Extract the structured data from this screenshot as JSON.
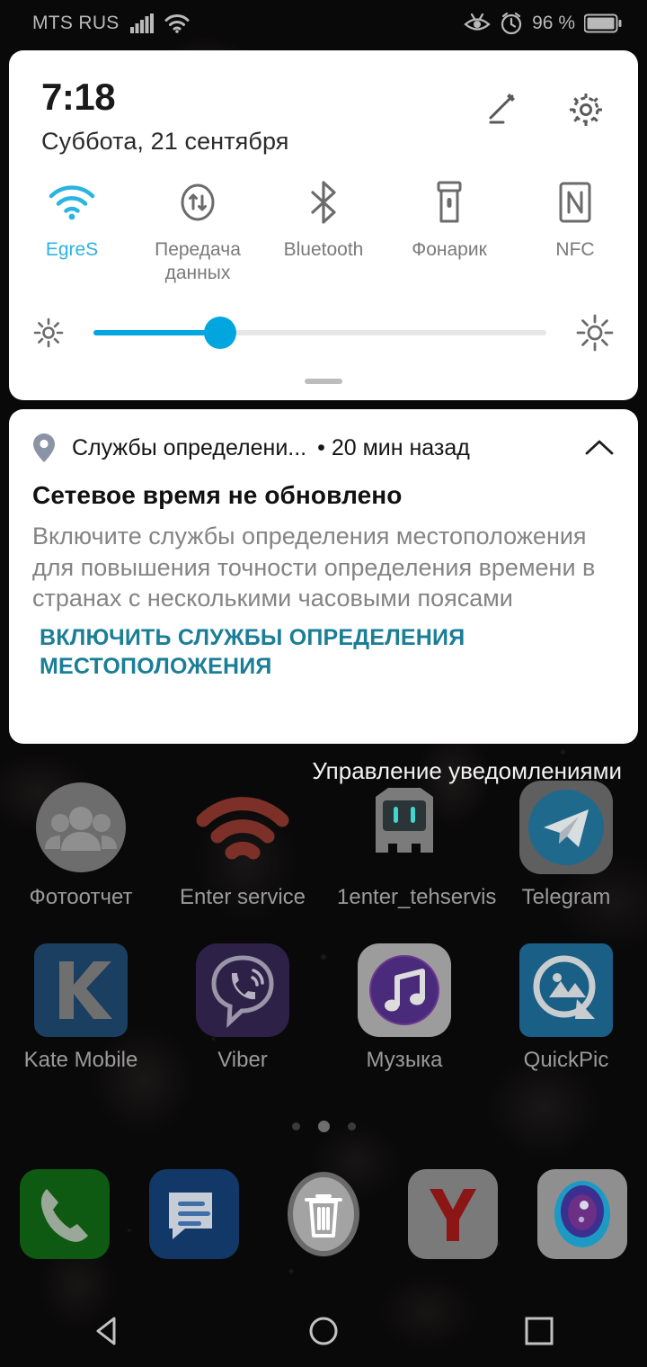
{
  "status_bar": {
    "carrier": "MTS RUS",
    "battery_percent": "96 %",
    "icons": [
      "signal-bars-icon",
      "wifi-icon",
      "eye-comfort-icon",
      "alarm-clock-icon",
      "battery-icon"
    ]
  },
  "quick_settings": {
    "time": "7:18",
    "date": "Суббота, 21 сентября",
    "edit_icon": "pencil-edit-icon",
    "settings_icon": "gear-icon",
    "active_color": "#2ab4e0",
    "toggles": [
      {
        "label": "EgreS",
        "icon": "wifi-icon",
        "active": true
      },
      {
        "label": "Передача данных",
        "icon": "data-transfer-icon",
        "active": false
      },
      {
        "label": "Bluetooth",
        "icon": "bluetooth-icon",
        "active": false
      },
      {
        "label": "Фонарик",
        "icon": "flashlight-icon",
        "active": false
      },
      {
        "label": "NFC",
        "icon": "nfc-icon",
        "active": false
      }
    ],
    "brightness": {
      "low_icon": "brightness-low-icon",
      "high_icon": "brightness-high-icon",
      "value_percent": 28,
      "fill_color": "#00a6dd"
    },
    "drag_handle": "panel-drag-handle"
  },
  "notification": {
    "app_icon": "location-pin-icon",
    "app_name": "Службы определени...",
    "timestamp": "• 20 мин назад",
    "collapse_icon": "chevron-up-icon",
    "title": "Сетевое время не обновлено",
    "body": "Включите службы определения место­положения для повышения точности определения времени в странах с несколькими часовыми поясами",
    "action_label": "ВКЛЮЧИТЬ СЛУЖБЫ ОПРЕДЕЛЕНИЯ МЕСТОПОЛОЖЕНИЯ",
    "action_color": "#1a7e96"
  },
  "manage_notifications_label": "Управление уведомлениями",
  "home_screen": {
    "rows": [
      [
        {
          "label": "Фотоотчет",
          "icon": "people-group-icon"
        },
        {
          "label": "Enter service",
          "icon": "wifi-arcs-icon"
        },
        {
          "label": "1enter_tehservis",
          "icon": "robot-console-icon"
        },
        {
          "label": "Telegram",
          "icon": "telegram-paper-plane-icon"
        }
      ],
      [
        {
          "label": "Kate Mobile",
          "icon": "letter-k-icon"
        },
        {
          "label": "Viber",
          "icon": "viber-phone-bubble-icon"
        },
        {
          "label": "Музыка",
          "icon": "music-note-icon"
        },
        {
          "label": "QuickPic",
          "icon": "quickpic-photo-icon"
        }
      ]
    ],
    "page_dots": {
      "count": 3,
      "active_index": 1
    }
  },
  "dock": [
    {
      "name": "phone-dialer-icon"
    },
    {
      "name": "messages-icon"
    },
    {
      "name": "trash-delete-icon"
    },
    {
      "name": "yandex-browser-icon"
    },
    {
      "name": "camera-icon"
    }
  ],
  "nav_bar": [
    {
      "name": "back-button-icon"
    },
    {
      "name": "home-button-icon"
    },
    {
      "name": "recents-button-icon"
    }
  ]
}
